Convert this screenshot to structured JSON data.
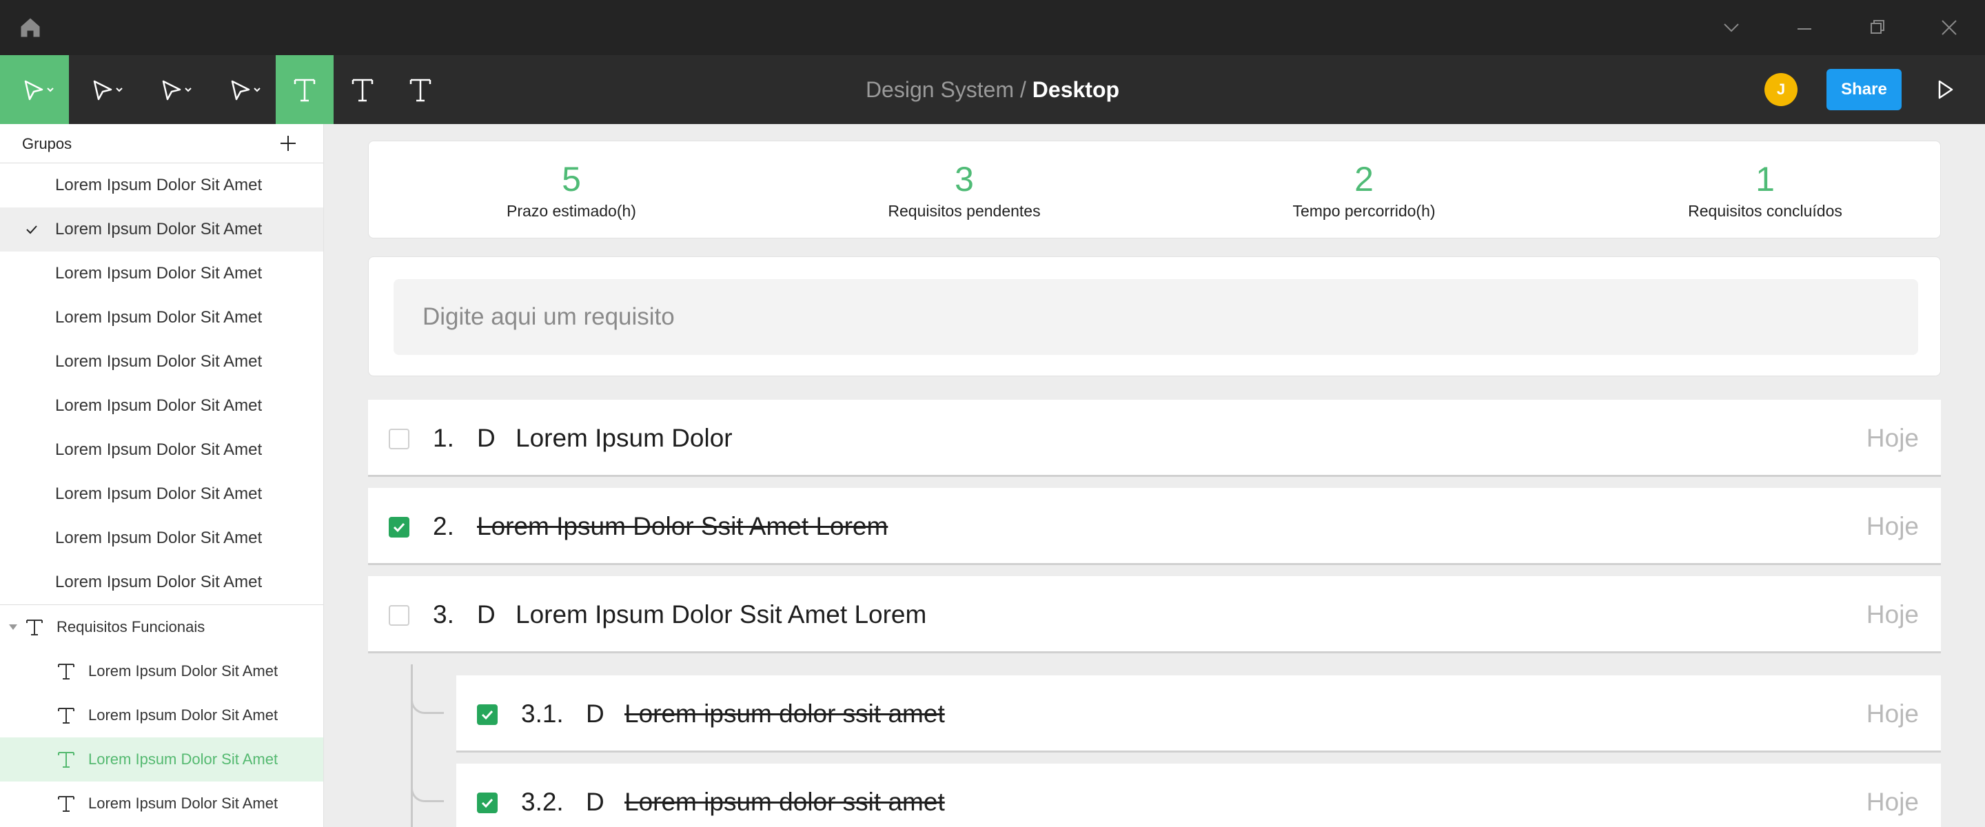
{
  "window": {
    "home_icon": "home-icon",
    "controls": [
      "chevron-down-icon",
      "minimize-icon",
      "restore-icon",
      "close-icon"
    ]
  },
  "toolbar": {
    "tools": [
      "move-tool",
      "pen-tool",
      "pen-tool",
      "pen-tool",
      "text-tool",
      "text-tool",
      "text-tool"
    ],
    "breadcrumb_parent": "Design System",
    "breadcrumb_sep": " / ",
    "breadcrumb_current": "Desktop",
    "avatar_initial": "J",
    "share_label": "Share",
    "accent": "#5bbf78",
    "share_color": "#1c9bf0"
  },
  "sidebar": {
    "title": "Grupos",
    "items": [
      {
        "label": "Lorem Ipsum Dolor Sit Amet",
        "selected": false
      },
      {
        "label": "Lorem Ipsum Dolor Sit Amet",
        "selected": true
      },
      {
        "label": "Lorem Ipsum Dolor Sit Amet",
        "selected": false
      },
      {
        "label": "Lorem Ipsum Dolor Sit Amet",
        "selected": false
      },
      {
        "label": "Lorem Ipsum Dolor Sit Amet",
        "selected": false
      },
      {
        "label": "Lorem Ipsum Dolor Sit Amet",
        "selected": false
      },
      {
        "label": "Lorem Ipsum Dolor Sit Amet",
        "selected": false
      },
      {
        "label": "Lorem Ipsum Dolor Sit Amet",
        "selected": false
      },
      {
        "label": "Lorem Ipsum Dolor Sit Amet",
        "selected": false
      },
      {
        "label": "Lorem Ipsum Dolor Sit Amet",
        "selected": false
      }
    ],
    "group": {
      "label": "Requisitos Funcionais",
      "children": [
        {
          "label": "Lorem Ipsum Dolor Sit Amet",
          "active": false
        },
        {
          "label": "Lorem Ipsum Dolor Sit Amet",
          "active": false
        },
        {
          "label": "Lorem Ipsum Dolor Sit Amet",
          "active": true
        },
        {
          "label": "Lorem Ipsum Dolor Sit Amet",
          "active": false
        }
      ]
    }
  },
  "stats": [
    {
      "value": "5",
      "label": "Prazo estimado(h)"
    },
    {
      "value": "3",
      "label": "Requisitos pendentes"
    },
    {
      "value": "2",
      "label": "Tempo percorrido(h)"
    },
    {
      "value": "1",
      "label": "Requisitos concluídos"
    }
  ],
  "input": {
    "placeholder": "Digite aqui um requisito",
    "value": ""
  },
  "requirements": [
    {
      "number": "1.",
      "tag": "D",
      "title": "Lorem Ipsum Dolor",
      "date": "Hoje",
      "checked": false
    },
    {
      "number": "2.",
      "tag": "",
      "title": "Lorem Ipsum Dolor Ssit Amet Lorem",
      "date": "Hoje",
      "checked": true
    },
    {
      "number": "3.",
      "tag": "D",
      "title": "Lorem Ipsum Dolor Ssit Amet Lorem",
      "date": "Hoje",
      "checked": false
    },
    {
      "number": "3.1.",
      "tag": "D",
      "title": "Lorem ipsum dolor ssit amet",
      "date": "Hoje",
      "checked": true
    },
    {
      "number": "3.2.",
      "tag": "D",
      "title": "Lorem ipsum dolor ssit amet",
      "date": "Hoje",
      "checked": true
    }
  ],
  "colors": {
    "green": "#4fbb76",
    "check_green": "#26a65b",
    "muted": "#b9b9b9"
  }
}
